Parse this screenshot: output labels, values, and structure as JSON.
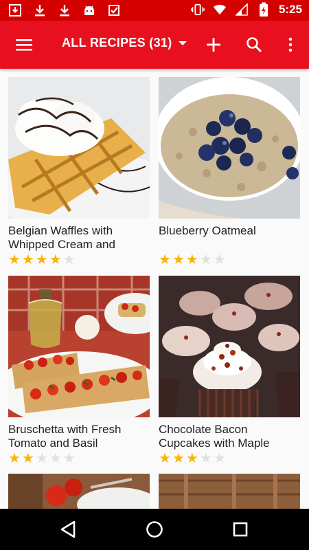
{
  "status": {
    "time": "5:25"
  },
  "appbar": {
    "title": "ALL RECIPES (31)"
  },
  "recipes": [
    {
      "name": "Belgian Waffles with Whipped Cream and Chocolate",
      "rating": 4
    },
    {
      "name": "Blueberry Oatmeal",
      "rating": 3
    },
    {
      "name": "Bruschetta with Fresh Tomato and Basil",
      "rating": 2
    },
    {
      "name": "Chocolate Bacon Cupcakes with Maple Frosting",
      "rating": 3
    }
  ],
  "colors": {
    "primary": "#e8101e",
    "status": "#d50000",
    "star_on": "#f9b40c",
    "star_off": "#e0e0e0"
  },
  "icons": {
    "menu": "menu-icon",
    "add": "add-icon",
    "search": "search-icon",
    "more": "more-vert-icon"
  }
}
